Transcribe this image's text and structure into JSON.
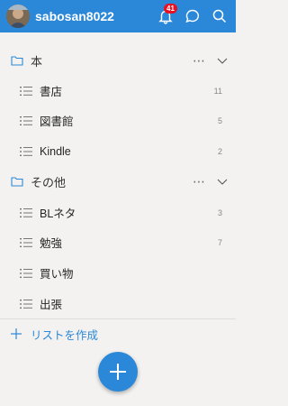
{
  "header": {
    "username": "sabosan8022",
    "notification_count": "41",
    "icons": [
      "bell-icon",
      "chat-icon",
      "search-icon"
    ],
    "background_color": "#2b88d8"
  },
  "groups": [
    {
      "label": "本",
      "more": "⋯",
      "items": [
        {
          "label": "書店",
          "count": "11"
        },
        {
          "label": "図書館",
          "count": "5"
        },
        {
          "label": "Kindle",
          "count": "2"
        }
      ]
    },
    {
      "label": "その他",
      "more": "⋯",
      "items": [
        {
          "label": "BLネタ",
          "count": "3"
        },
        {
          "label": "勉強",
          "count": "7"
        },
        {
          "label": "買い物",
          "count": ""
        },
        {
          "label": "出張",
          "count": ""
        }
      ]
    }
  ],
  "new_list": {
    "label": "リストを作成"
  },
  "colors": {
    "accent": "#2b88d8",
    "badge": "#e81123",
    "background": "#f3f2f1"
  }
}
